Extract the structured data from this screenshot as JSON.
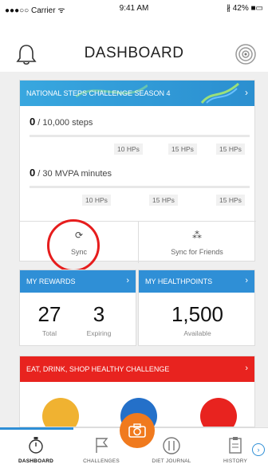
{
  "status_bar": {
    "carrier": "●●●○○ Carrier ᯤ",
    "time": "9:41 AM",
    "battery": "∦ 42% ■▭"
  },
  "header": {
    "title": "DASHBOARD"
  },
  "steps_challenge": {
    "banner": "NATIONAL STEPS CHALLENGE SEASON 4",
    "steps": {
      "value": "0",
      "goal": " / 10,000 steps",
      "hp_labels": [
        "10 HPs",
        "15 HPs",
        "15 HPs"
      ]
    },
    "mvpa": {
      "value": "0",
      "goal": " / 30 MVPA minutes",
      "hp_labels": [
        "10 HPs",
        "15 HPs",
        "15 HPs"
      ]
    },
    "sync_label": "Sync",
    "sync_friends_label": "Sync for Friends"
  },
  "rewards": {
    "title": "MY REWARDS",
    "total_value": "27",
    "total_label": "Total",
    "expiring_value": "3",
    "expiring_label": "Expiring"
  },
  "healthpoints": {
    "title": "MY HEALTHPOINTS",
    "value": "1,500",
    "label": "Available"
  },
  "healthy_challenge": {
    "title": "EAT, DRINK, SHOP HEALTHY CHALLENGE"
  },
  "tabs": [
    {
      "label": "DASHBOARD"
    },
    {
      "label": "CHALLENGES"
    },
    {
      "label": "DIET JOURNAL"
    },
    {
      "label": "HISTORY"
    }
  ],
  "colors": {
    "accent_blue": "#2f8fd6",
    "challenge_red": "#e8231f",
    "camera_orange": "#f07a1e",
    "highlight_red": "#e61d1d"
  }
}
